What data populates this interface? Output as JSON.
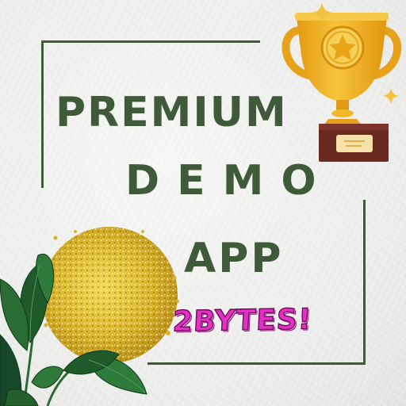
{
  "title": {
    "line1": "PREMIUM",
    "line2": "DEMO",
    "line3": "APP"
  },
  "brand": "2BYTES!",
  "colors": {
    "title_green": "#3e5a38",
    "frame_green": "#3e5a38",
    "brand_pink": "#e431c5",
    "trophy_gold": "#f2b21f",
    "glitter_gold": "#d9b42a",
    "plant_green": "#1f5a2a"
  },
  "icons": [
    "trophy-icon",
    "sparkle-icon",
    "glitter-circle",
    "plant-leaves"
  ]
}
